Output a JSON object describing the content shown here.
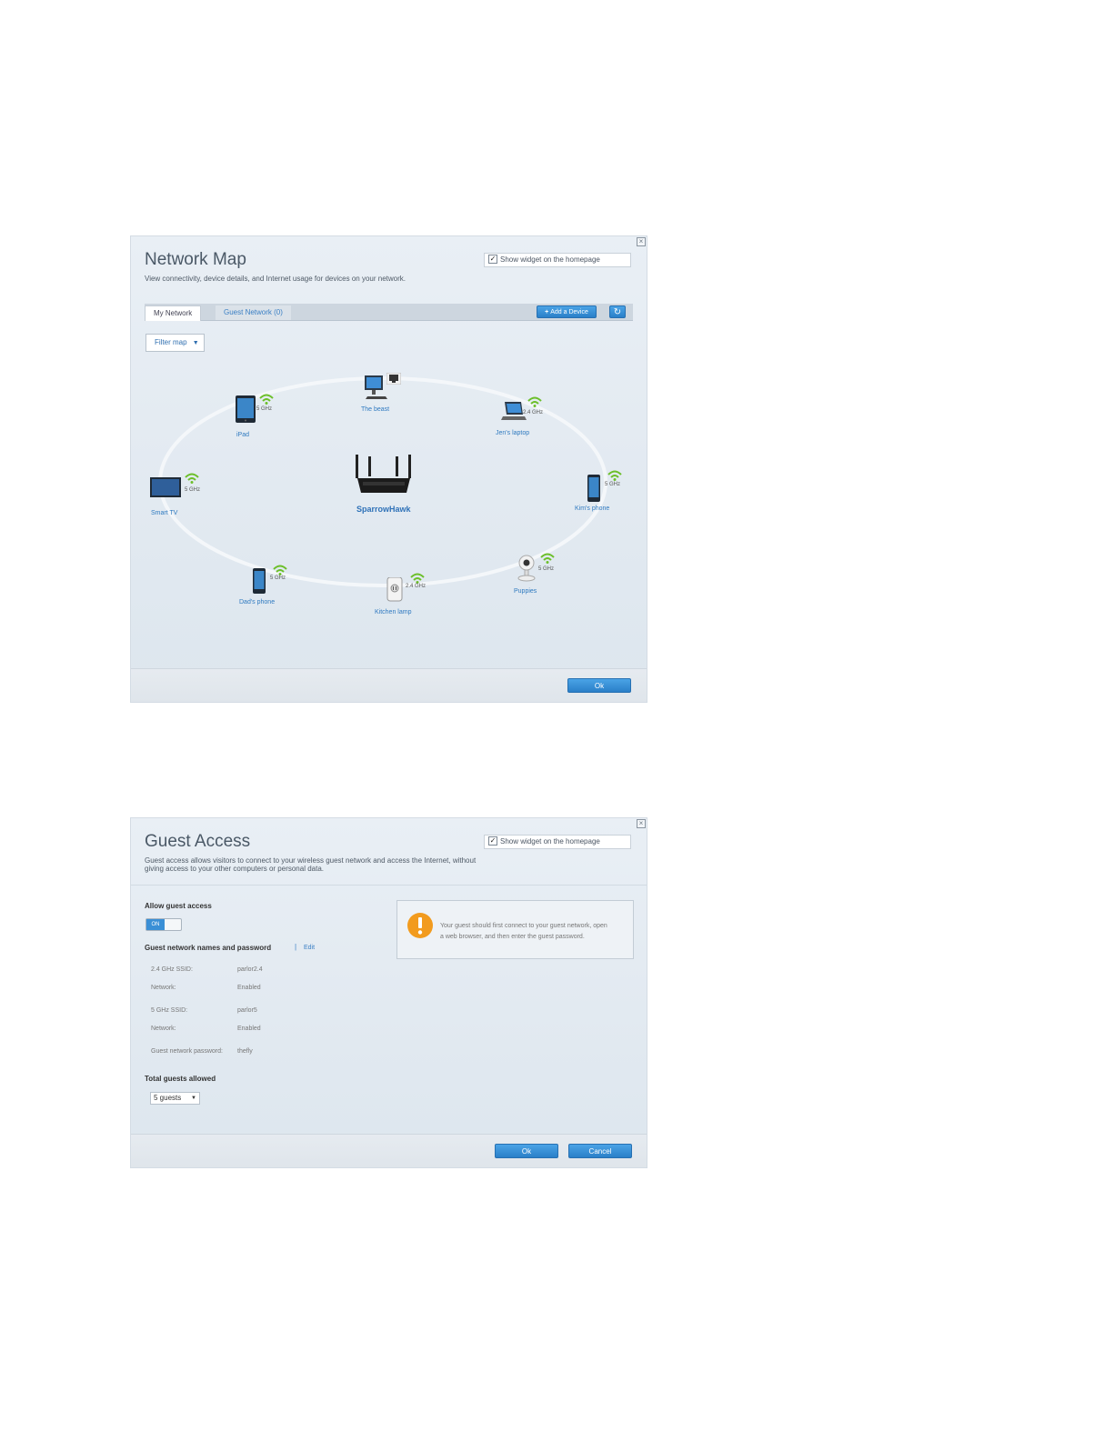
{
  "network_map": {
    "title": "Network Map",
    "description": "View connectivity, device details, and Internet usage for devices on your network.",
    "show_widget_label": "Show widget on the homepage",
    "tabs": [
      "My Network",
      "Guest Network (0)"
    ],
    "add_device_label": "Add a Device",
    "filter_label": "Filter map",
    "router_name": "SparrowHawk",
    "devices": [
      {
        "name": "The beast",
        "band": ""
      },
      {
        "name": "iPad",
        "band": "5 GHz"
      },
      {
        "name": "Jen's laptop",
        "band": "2.4 GHz"
      },
      {
        "name": "Smart TV",
        "band": "5 GHz"
      },
      {
        "name": "Kim's phone",
        "band": "5 GHz"
      },
      {
        "name": "Dad's phone",
        "band": "5 GHz"
      },
      {
        "name": "Kitchen lamp",
        "band": "2.4 GHz"
      },
      {
        "name": "Puppies",
        "band": "5 GHz"
      }
    ],
    "ok_label": "Ok"
  },
  "guest_access": {
    "title": "Guest Access",
    "description_line1": "Guest access allows visitors to connect to your wireless guest network and access the Internet, without",
    "description_line2": "giving access to your other computers or personal data.",
    "show_widget_label": "Show widget on the homepage",
    "allow_label": "Allow guest access",
    "toggle_label": "ON",
    "names_password_label": "Guest network names and password",
    "edit_label": "Edit",
    "fields": [
      {
        "key": "2.4 GHz SSID:",
        "value": "parlor2.4"
      },
      {
        "key": "Network:",
        "value": "Enabled"
      },
      {
        "key": "5 GHz SSID:",
        "value": "parlor5"
      },
      {
        "key": "Network:",
        "value": "Enabled"
      },
      {
        "key": "Guest network password:",
        "value": "thefly"
      }
    ],
    "total_guests_label": "Total guests allowed",
    "guests_value": "5 guests",
    "info_line1": "Your guest should first connect to your guest network, open",
    "info_line2": "a web browser, and then enter the guest password.",
    "ok_label": "Ok",
    "cancel_label": "Cancel"
  }
}
